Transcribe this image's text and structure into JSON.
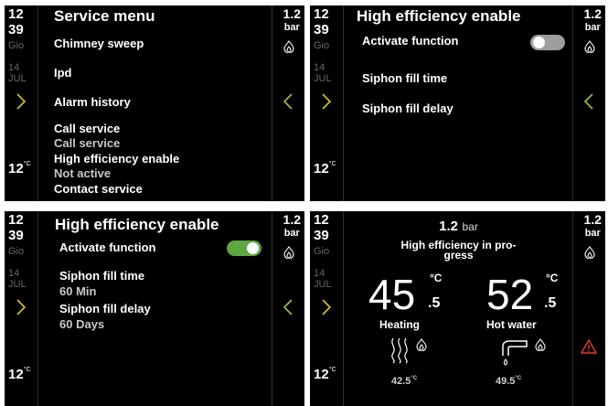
{
  "status": {
    "hour": "12",
    "minute": "39",
    "day_name": "Gio",
    "day_number": "14",
    "month": "JUL",
    "outdoor_temp": "12",
    "outdoor_temp_unit": "°C",
    "pressure_value": "1.2",
    "pressure_unit": "bar"
  },
  "service_menu": {
    "title": "Service menu",
    "items": [
      {
        "label": "Chimney sweep"
      },
      {
        "label": "Ipd"
      },
      {
        "label": "Alarm history"
      },
      {
        "label": "Call service",
        "value": "Call service"
      },
      {
        "label": "High efficiency enable",
        "value": "Not active"
      },
      {
        "label": "Contact service"
      }
    ]
  },
  "he_off": {
    "title": "High efficiency enable",
    "activate_label": "Activate function",
    "toggle_on": false,
    "fill_time_label": "Siphon fill time",
    "fill_delay_label": "Siphon fill delay"
  },
  "he_on": {
    "title": "High efficiency enable",
    "activate_label": "Activate function",
    "toggle_on": true,
    "fill_time_label": "Siphon fill time",
    "fill_time_value": "60 Min",
    "fill_delay_label": "Siphon fill delay",
    "fill_delay_value": "60 Days"
  },
  "home": {
    "pressure_value": "1.2",
    "pressure_unit": "bar",
    "status_line1": "High efficiency in pro-",
    "status_line2": "gress",
    "heating": {
      "int": "45",
      "dec": ".5",
      "unit": "°C",
      "label": "Heating",
      "actual": "42.5",
      "actual_unit": "°C"
    },
    "hot_water": {
      "int": "52",
      "dec": ".5",
      "unit": "°C",
      "label": "Hot water",
      "actual": "49.5",
      "actual_unit": "°C"
    },
    "alert_icon": "warning-triangle-icon"
  },
  "colors": {
    "background": "#000000",
    "toggle_on": "#5ea640",
    "toggle_off": "#9e9e9e",
    "arrow_right": "#d9c62a",
    "arrow_left": "#9bc23a",
    "warning": "#e53935",
    "dim_text": "#666666"
  }
}
